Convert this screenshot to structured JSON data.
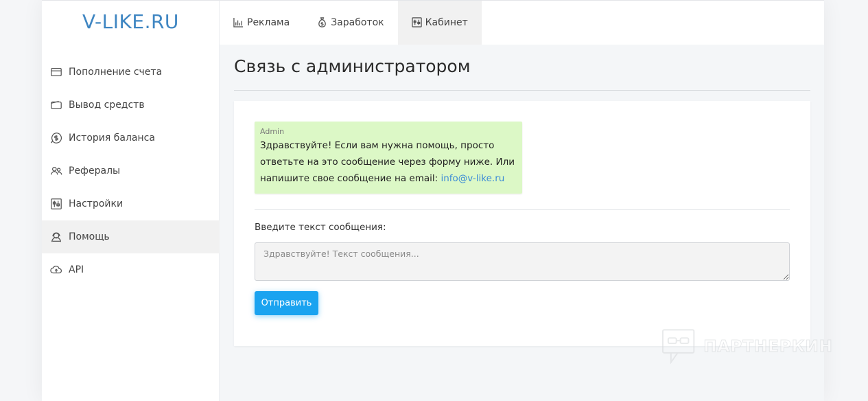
{
  "brand": {
    "logo_text": "V-LIKE.RU"
  },
  "topnav": {
    "tabs": [
      {
        "label": "Реклама",
        "icon": "bar-chart-icon",
        "active": false
      },
      {
        "label": "Заработок",
        "icon": "money-bag-icon",
        "active": false
      },
      {
        "label": "Кабинет",
        "icon": "dashboard-icon",
        "active": true
      }
    ]
  },
  "sidebar": {
    "items": [
      {
        "label": "Пополнение счета",
        "icon": "credit-card-icon",
        "active": false
      },
      {
        "label": "Вывод средств",
        "icon": "wallet-icon",
        "active": false
      },
      {
        "label": "История баланса",
        "icon": "coin-chat-icon",
        "active": false
      },
      {
        "label": "Рефералы",
        "icon": "users-icon",
        "active": false
      },
      {
        "label": "Настройки",
        "icon": "sliders-icon",
        "active": false
      },
      {
        "label": "Помощь",
        "icon": "support-agent-icon",
        "active": true
      },
      {
        "label": "API",
        "icon": "cloud-upload-icon",
        "active": false
      }
    ]
  },
  "page": {
    "title": "Связь с администратором"
  },
  "chat": {
    "message": {
      "author": "Admin",
      "text_before_link": "Здравствуйте! Если вам нужна помощь, просто ответьте на это сообщение через форму ниже. Или напишите свое сообщение на email: ",
      "link_text": "info@v-like.ru"
    }
  },
  "form": {
    "label": "Введите текст сообщения:",
    "value": "",
    "placeholder": "Здравствуйте! Текст сообщения...",
    "submit_label": "Отправить"
  },
  "watermark": {
    "text": "ПАРТНЕРКИН"
  },
  "colors": {
    "brand": "#3f86c2",
    "button": "#1aa3f0",
    "message_bg": "#dcf8c6",
    "link": "#3b8bd6"
  }
}
